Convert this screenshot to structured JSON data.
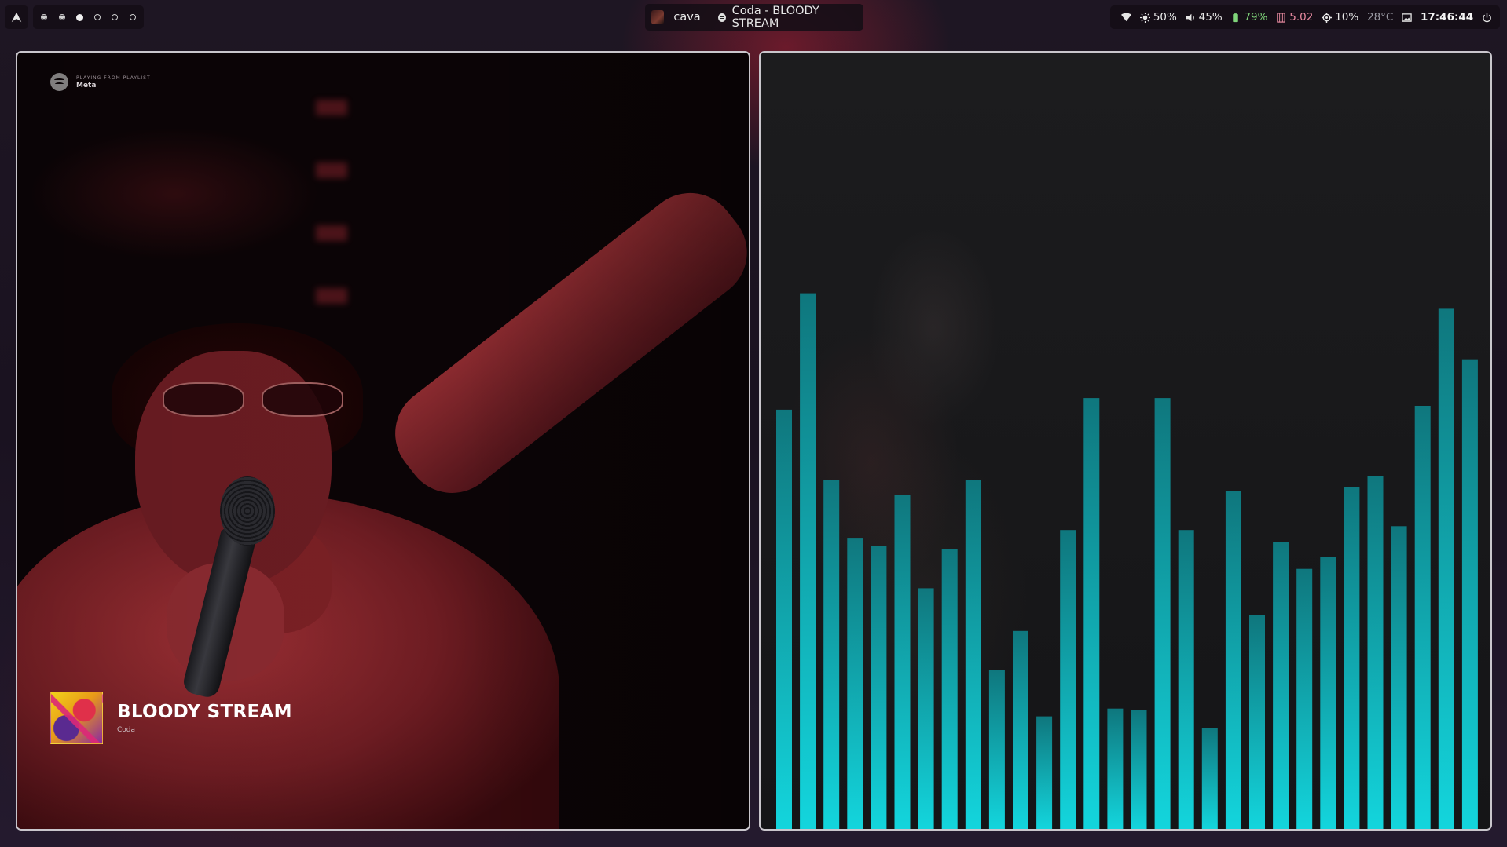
{
  "bar": {
    "launcher": {
      "icon": "arch-logo-icon"
    },
    "workspaces": [
      {
        "id": 1,
        "state": "occupied"
      },
      {
        "id": 2,
        "state": "occupied"
      },
      {
        "id": 3,
        "state": "active"
      },
      {
        "id": 4,
        "state": "empty"
      },
      {
        "id": 5,
        "state": "empty"
      },
      {
        "id": 6,
        "state": "empty"
      }
    ],
    "active_window": "cava",
    "media": "Coda - BLOODY STREAM",
    "status": {
      "brightness": "50%",
      "volume": "45%",
      "battery": "79%",
      "memory": "5.02",
      "cpu": "10%",
      "temperature": "28°C",
      "clock": "17:46:44"
    }
  },
  "spotify": {
    "playlist_kicker": "PLAYING FROM PLAYLIST",
    "playlist_name": "Meta",
    "track_title": "BLOODY STREAM",
    "track_artist": "Coda"
  },
  "chart_data": {
    "type": "bar",
    "values": [
      0.54,
      0.69,
      0.45,
      0.375,
      0.365,
      0.43,
      0.31,
      0.36,
      0.45,
      0.205,
      0.255,
      0.145,
      0.385,
      0.555,
      0.155,
      0.153,
      0.555,
      0.385,
      0.13,
      0.435,
      0.275,
      0.37,
      0.335,
      0.35,
      0.44,
      0.455,
      0.39,
      0.545,
      0.67,
      0.605
    ],
    "ylim": [
      0,
      1
    ],
    "colors": {
      "bar_top": "#0e7f86",
      "bar_bottom": "#13e6ee"
    }
  }
}
